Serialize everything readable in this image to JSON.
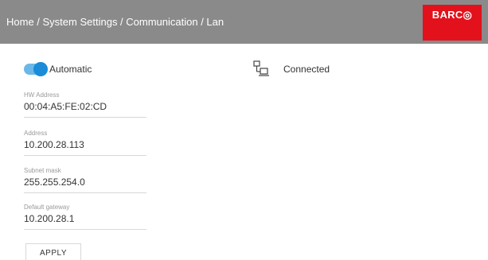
{
  "header": {
    "breadcrumb": "Home / System Settings / Communication / Lan",
    "logo_text": "BARC◎",
    "background_color": "#8a8a8a",
    "logo_color": "#e3111b"
  },
  "mode": {
    "label": "Automatic",
    "enabled": true,
    "toggle_color": "#1a8cd8"
  },
  "status": {
    "icon": "network-icon",
    "text": "Connected"
  },
  "fields": {
    "hw_address": {
      "label": "HW Address",
      "value": "00:04:A5:FE:02:CD"
    },
    "address": {
      "label": "Address",
      "value": "10.200.28.113"
    },
    "subnet_mask": {
      "label": "Subnet mask",
      "value": "255.255.254.0"
    },
    "default_gateway": {
      "label": "Default gateway",
      "value": "10.200.28.1"
    }
  },
  "actions": {
    "apply_label": "APPLY"
  }
}
